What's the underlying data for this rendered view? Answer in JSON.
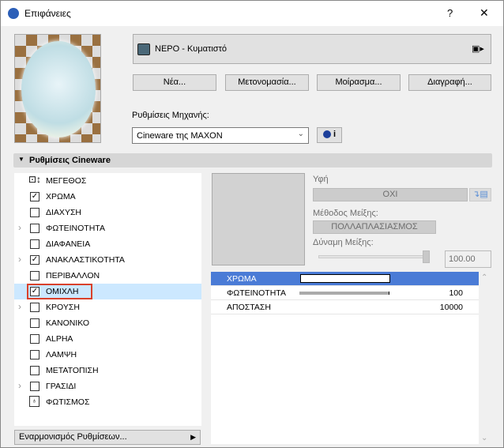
{
  "window": {
    "title": "Επιφάνειες",
    "help": "?",
    "close": "✕"
  },
  "material": {
    "name": "ΝΕΡΟ - Κυματιστό",
    "swatch_color": "#4a6878"
  },
  "buttons": {
    "new": "Νέα...",
    "rename": "Μετονομασία...",
    "share": "Μοίρασμα...",
    "delete": "Διαγραφή..."
  },
  "engine": {
    "label": "Ρυθμίσεις Μηχανής:",
    "value": "Cineware της MAXON",
    "info": "i"
  },
  "section": {
    "title": "Ρυθμίσεις Cineware"
  },
  "channels": [
    {
      "label": "ΜΕΓΕΘΟΣ",
      "type": "size-icon",
      "expand": false,
      "checked": false
    },
    {
      "label": "ΧΡΩΜΑ",
      "type": "checkbox",
      "expand": false,
      "checked": true
    },
    {
      "label": "ΔΙΑΧΥΣΗ",
      "type": "checkbox",
      "expand": false,
      "checked": false
    },
    {
      "label": "ΦΩΤΕΙΝΟΤΗΤΑ",
      "type": "checkbox",
      "expand": true,
      "checked": false
    },
    {
      "label": "ΔΙΑΦΑΝΕΙΑ",
      "type": "checkbox",
      "expand": false,
      "checked": false
    },
    {
      "label": "ΑΝΑΚΛΑΣΤΙΚΟΤΗΤΑ",
      "type": "checkbox",
      "expand": true,
      "checked": true
    },
    {
      "label": "ΠΕΡΙΒΑΛΛΟΝ",
      "type": "checkbox",
      "expand": false,
      "checked": false
    },
    {
      "label": "ΟΜΙΧΛΗ",
      "type": "checkbox",
      "expand": false,
      "checked": true,
      "selected": true
    },
    {
      "label": "ΚΡΟΥΣΗ",
      "type": "checkbox",
      "expand": true,
      "checked": false
    },
    {
      "label": "ΚΑΝΟΝΙΚΟ",
      "type": "checkbox",
      "expand": false,
      "checked": false
    },
    {
      "label": "ALPHA",
      "type": "checkbox",
      "expand": false,
      "checked": false
    },
    {
      "label": "ΛΑΜΨΗ",
      "type": "checkbox",
      "expand": false,
      "checked": false
    },
    {
      "label": "ΜΕΤΑΤΟΠΙΣΗ",
      "type": "checkbox",
      "expand": false,
      "checked": false
    },
    {
      "label": "ΓΡΑΣΙΔΙ",
      "type": "checkbox",
      "expand": true,
      "checked": false
    },
    {
      "label": "ΦΩΤΙΣΜΟΣ",
      "type": "light-icon",
      "expand": false,
      "checked": false
    }
  ],
  "footer": {
    "label": "Εναρμονισμός Ρυθμίσεων..."
  },
  "texture": {
    "label": "Υφή",
    "value": "ΟΧΙ",
    "blend_label": "Μέθοδος Μείξης:",
    "blend_value": "ΠΟΛΛΑΠΛΑΣΙΑΣΜΟΣ",
    "strength_label": "Δύναμη Μείξης:",
    "strength_value": "100.00",
    "strength_fraction": 1.0
  },
  "params": [
    {
      "name": "ΧΡΩΜΑ",
      "kind": "color",
      "color": "#ffffff",
      "selected": true
    },
    {
      "name": "ΦΩΤΕΙΝΟΤΗΤΑ",
      "kind": "bar",
      "value": "100",
      "fraction": 1.0
    },
    {
      "name": "ΑΠΟΣΤΑΣΗ",
      "kind": "number",
      "value": "10000"
    }
  ],
  "colors": {
    "selection": "#4a7bd6",
    "list_highlight": "#cce8ff",
    "focus_border": "#d9412b"
  }
}
